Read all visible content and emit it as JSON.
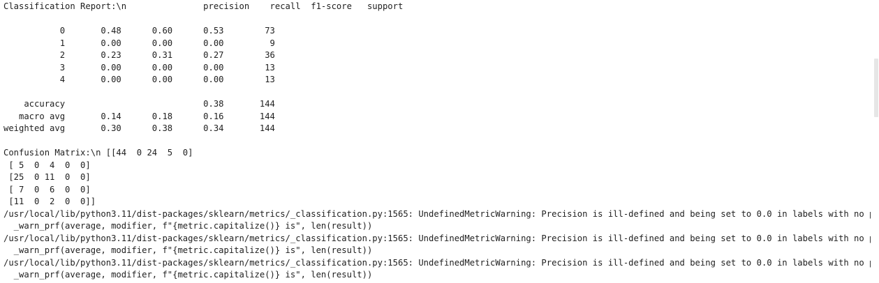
{
  "output": {
    "lines": [
      "Classification Report:\\n               precision    recall  f1-score   support",
      "",
      "           0       0.48      0.60      0.53        73",
      "           1       0.00      0.00      0.00         9",
      "           2       0.23      0.31      0.27        36",
      "           3       0.00      0.00      0.00        13",
      "           4       0.00      0.00      0.00        13",
      "",
      "    accuracy                           0.38       144",
      "   macro avg       0.14      0.18      0.16       144",
      "weighted avg       0.30      0.38      0.34       144",
      "",
      "Confusion Matrix:\\n [[44  0 24  5  0]",
      " [ 5  0  4  0  0]",
      " [25  0 11  0  0]",
      " [ 7  0  6  0  0]",
      " [11  0  2  0  0]]",
      "/usr/local/lib/python3.11/dist-packages/sklearn/metrics/_classification.py:1565: UndefinedMetricWarning: Precision is ill-defined and being set to 0.0 in labels with no predicted samples. Use `zero_division` parameter to control this behavior.",
      "  _warn_prf(average, modifier, f\"{metric.capitalize()} is\", len(result))",
      "/usr/local/lib/python3.11/dist-packages/sklearn/metrics/_classification.py:1565: UndefinedMetricWarning: Precision is ill-defined and being set to 0.0 in labels with no predicted samples. Use `zero_division` parameter to control this behavior.",
      "  _warn_prf(average, modifier, f\"{metric.capitalize()} is\", len(result))",
      "/usr/local/lib/python3.11/dist-packages/sklearn/metrics/_classification.py:1565: UndefinedMetricWarning: Precision is ill-defined and being set to 0.0 in labels with no predicted samples. Use `zero_division` parameter to control this behavior.",
      "  _warn_prf(average, modifier, f\"{metric.capitalize()} is\", len(result))"
    ]
  },
  "colors": {
    "text": "#212121",
    "background": "#ffffff",
    "scrollbar_thumb": "#e6e6e6"
  }
}
